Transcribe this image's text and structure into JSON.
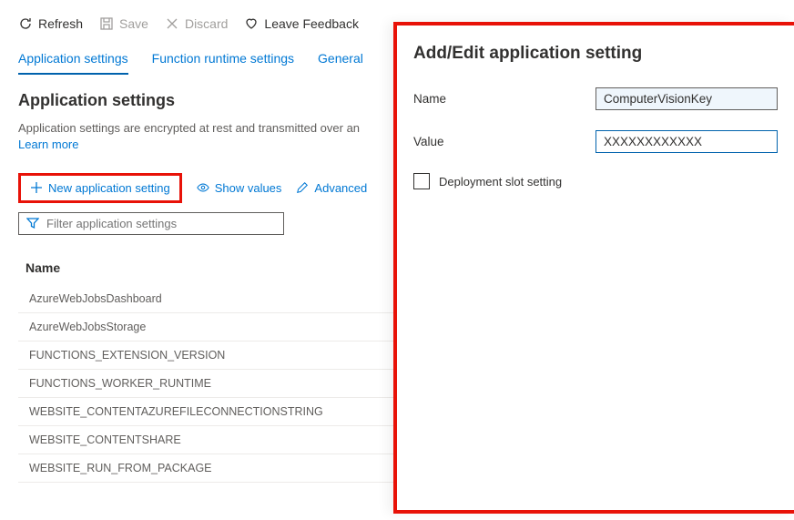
{
  "toolbar": {
    "refresh": "Refresh",
    "save": "Save",
    "discard": "Discard",
    "feedback": "Leave Feedback"
  },
  "tabs": {
    "app_settings": "Application settings",
    "runtime": "Function runtime settings",
    "general": "General"
  },
  "section": {
    "heading": "Application settings",
    "description": "Application settings are encrypted at rest and transmitted over an",
    "learn_more": "Learn more"
  },
  "actions": {
    "new_setting": "New application setting",
    "show_values": "Show values",
    "advanced": "Advanced"
  },
  "filter": {
    "placeholder": "Filter application settings"
  },
  "table": {
    "col_name": "Name",
    "rows": [
      "AzureWebJobsDashboard",
      "AzureWebJobsStorage",
      "FUNCTIONS_EXTENSION_VERSION",
      "FUNCTIONS_WORKER_RUNTIME",
      "WEBSITE_CONTENTAZUREFILECONNECTIONSTRING",
      "WEBSITE_CONTENTSHARE",
      "WEBSITE_RUN_FROM_PACKAGE"
    ]
  },
  "panel": {
    "title": "Add/Edit application setting",
    "name_label": "Name",
    "name_value": "ComputerVisionKey",
    "value_label": "Value",
    "value_value": "XXXXXXXXXXXX",
    "slot_label": "Deployment slot setting"
  }
}
